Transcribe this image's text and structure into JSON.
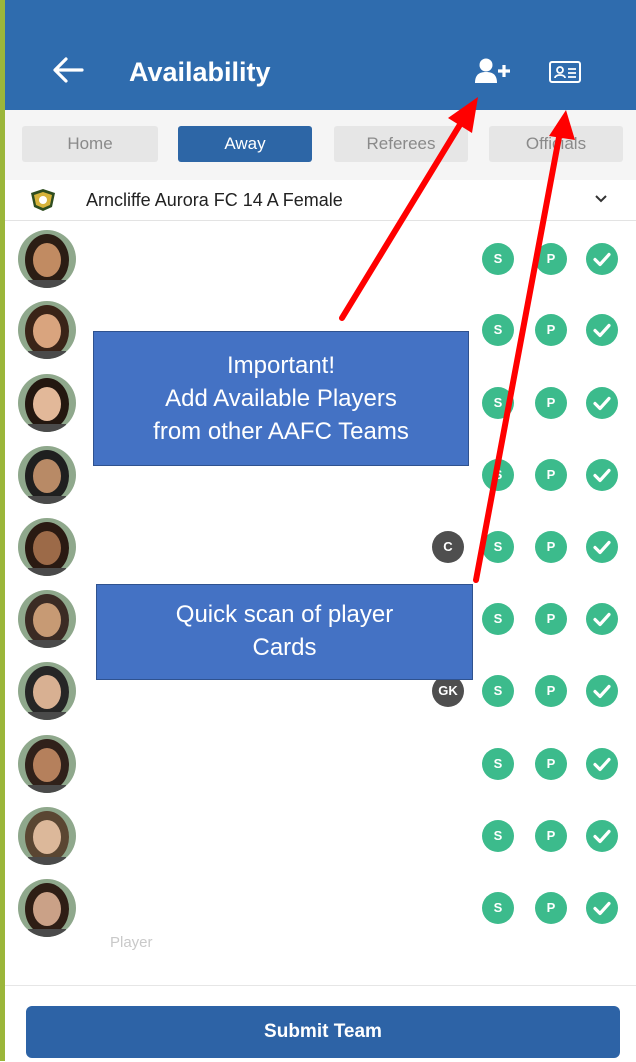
{
  "header": {
    "title": "Availability",
    "bg_color": "#2f6cae",
    "icons": [
      "back-arrow-icon",
      "add-user-icon",
      "player-card-icon"
    ]
  },
  "tabs": [
    {
      "label": "Home",
      "active": false
    },
    {
      "label": "Away",
      "active": true
    },
    {
      "label": "Referees",
      "active": false
    },
    {
      "label": "Officials",
      "active": false
    }
  ],
  "team": {
    "name": "Arncliffe Aurora FC 14 A Female"
  },
  "players": [
    {
      "role": "",
      "badges": [
        "S",
        "P"
      ]
    },
    {
      "role": "",
      "badges": [
        "S",
        "P"
      ]
    },
    {
      "role": "",
      "badges": [
        "S",
        "P"
      ]
    },
    {
      "role": "",
      "badges": [
        "S",
        "P"
      ]
    },
    {
      "role": "C",
      "badges": [
        "S",
        "P"
      ]
    },
    {
      "role": "",
      "badges": [
        "S",
        "P"
      ]
    },
    {
      "role": "GK",
      "badges": [
        "S",
        "P"
      ]
    },
    {
      "role": "",
      "badges": [
        "S",
        "P"
      ]
    },
    {
      "role": "",
      "badges": [
        "S",
        "P"
      ]
    },
    {
      "role": "",
      "badges": [
        "S",
        "P"
      ]
    }
  ],
  "faded_label": "Player",
  "callouts": {
    "important_line1": "Important!",
    "important_line2": "Add Available Players",
    "important_line3": "from other AAFC Teams",
    "scan_line1": "Quick scan of player",
    "scan_line2": "Cards"
  },
  "submit_label": "Submit Team",
  "colors": {
    "accent": "#2d63a6",
    "available_green": "#3cbb8c",
    "role_badge": "#4f4f4f",
    "callout_fill": "#4472c4",
    "arrow": "#ff0000"
  }
}
